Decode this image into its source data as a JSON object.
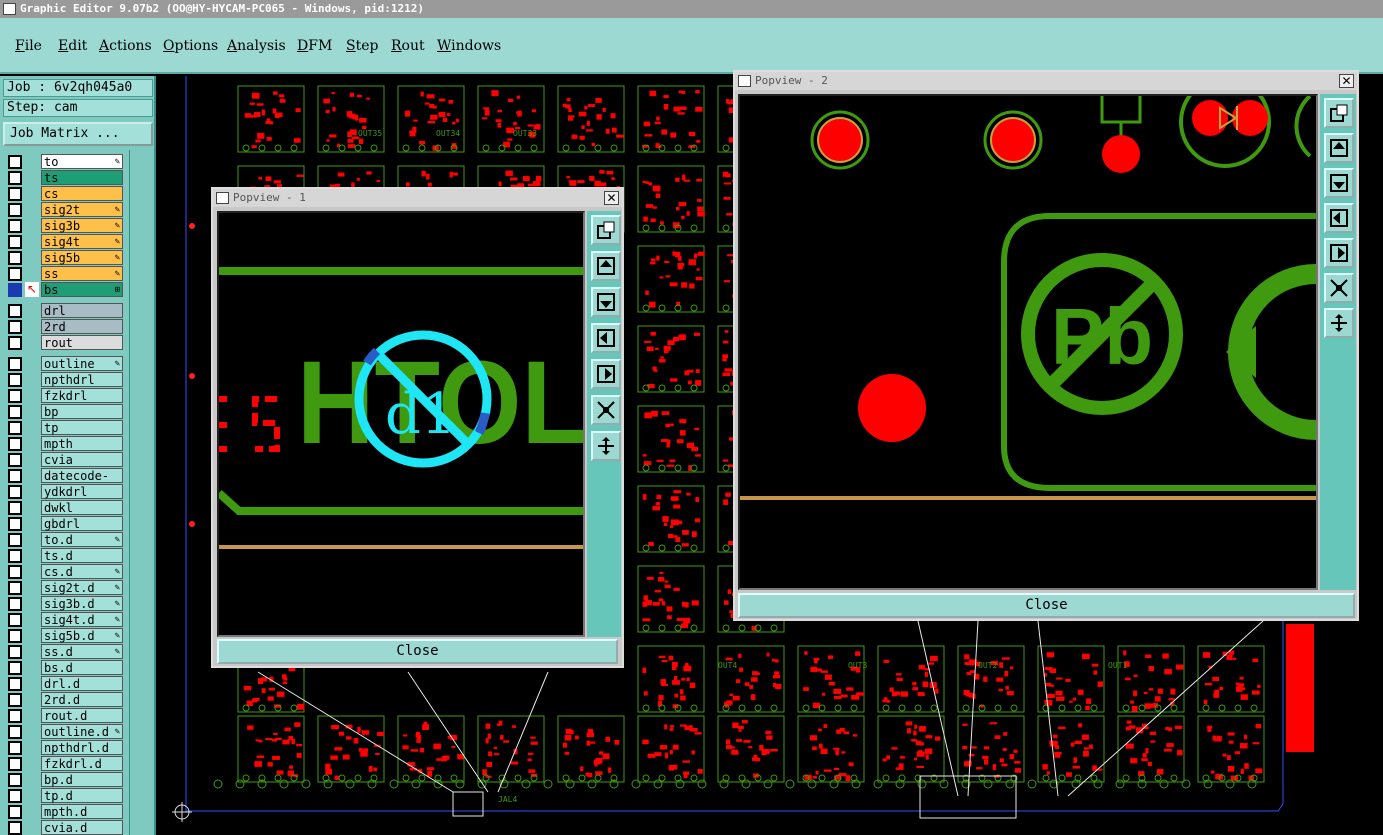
{
  "window": {
    "title": "Graphic Editor 9.07b2 (OO@HY-HYCAM-PC065 - Windows, pid:1212)"
  },
  "menu": [
    "File",
    "Edit",
    "Actions",
    "Options",
    "Analysis",
    "DFM",
    "Step",
    "Rout",
    "Windows"
  ],
  "job": {
    "label": "Job : 6v2qh045a0",
    "step": "Step: cam",
    "matrix_button": "Job Matrix ..."
  },
  "layers": [
    {
      "name": "to",
      "color": "#ffffff",
      "mark": "✎"
    },
    {
      "name": "ts",
      "color": "#1d9e74",
      "mark": ""
    },
    {
      "name": "cs",
      "color": "#ffc04a",
      "mark": ""
    },
    {
      "name": "sig2t",
      "color": "#ffc04a",
      "mark": "✎"
    },
    {
      "name": "sig3b",
      "color": "#ffc04a",
      "mark": "✎"
    },
    {
      "name": "sig4t",
      "color": "#ffc04a",
      "mark": "✎"
    },
    {
      "name": "sig5b",
      "color": "#ffc04a",
      "mark": "✎"
    },
    {
      "name": "ss",
      "color": "#ffc04a",
      "mark": "✎"
    },
    {
      "name": "bs",
      "color": "#1d9e74",
      "mark": "⊞"
    },
    {
      "name": "drl",
      "color": "#a7bcc4",
      "mark": ""
    },
    {
      "name": "2rd",
      "color": "#a7bcc4",
      "mark": ""
    },
    {
      "name": "rout",
      "color": "#dcdcdc",
      "mark": ""
    },
    {
      "name": "outline",
      "color": "#a4e0da",
      "mark": "✎"
    },
    {
      "name": "npthdrl",
      "color": "#a4e0da",
      "mark": ""
    },
    {
      "name": "fzkdrl",
      "color": "#a4e0da",
      "mark": ""
    },
    {
      "name": "bp",
      "color": "#a4e0da",
      "mark": ""
    },
    {
      "name": "tp",
      "color": "#a4e0da",
      "mark": ""
    },
    {
      "name": "mpth",
      "color": "#a4e0da",
      "mark": ""
    },
    {
      "name": "cvia",
      "color": "#a4e0da",
      "mark": ""
    },
    {
      "name": "datecode-bs",
      "color": "#a4e0da",
      "mark": ""
    },
    {
      "name": "ydkdrl",
      "color": "#a4e0da",
      "mark": ""
    },
    {
      "name": "dwkl",
      "color": "#a4e0da",
      "mark": ""
    },
    {
      "name": "gbdrl",
      "color": "#a4e0da",
      "mark": ""
    },
    {
      "name": "to.d",
      "color": "#a4e0da",
      "mark": "✎"
    },
    {
      "name": "ts.d",
      "color": "#a4e0da",
      "mark": ""
    },
    {
      "name": "cs.d",
      "color": "#a4e0da",
      "mark": "✎"
    },
    {
      "name": "sig2t.d",
      "color": "#a4e0da",
      "mark": "✎"
    },
    {
      "name": "sig3b.d",
      "color": "#a4e0da",
      "mark": "✎"
    },
    {
      "name": "sig4t.d",
      "color": "#a4e0da",
      "mark": "✎"
    },
    {
      "name": "sig5b.d",
      "color": "#a4e0da",
      "mark": "✎"
    },
    {
      "name": "ss.d",
      "color": "#a4e0da",
      "mark": "✎"
    },
    {
      "name": "bs.d",
      "color": "#a4e0da",
      "mark": ""
    },
    {
      "name": "drl.d",
      "color": "#a4e0da",
      "mark": ""
    },
    {
      "name": "2rd.d",
      "color": "#a4e0da",
      "mark": ""
    },
    {
      "name": "rout.d",
      "color": "#a4e0da",
      "mark": ""
    },
    {
      "name": "outline.d",
      "color": "#a4e0da",
      "mark": "✎"
    },
    {
      "name": "npthdrl.d",
      "color": "#a4e0da",
      "mark": ""
    },
    {
      "name": "fzkdrl.d",
      "color": "#a4e0da",
      "mark": ""
    },
    {
      "name": "bp.d",
      "color": "#a4e0da",
      "mark": ""
    },
    {
      "name": "tp.d",
      "color": "#a4e0da",
      "mark": ""
    },
    {
      "name": "mpth.d",
      "color": "#a4e0da",
      "mark": ""
    },
    {
      "name": "cvia.d",
      "color": "#a4e0da",
      "mark": ""
    }
  ],
  "popview1": {
    "title": "Popview - 1",
    "close_label": "Close",
    "silk_text": "HTOL",
    "drill_label": "d1"
  },
  "popview2": {
    "title": "Popview - 2",
    "close_label": "Close",
    "pb_label": "Pb"
  },
  "board_labels": [
    "OUT35",
    "OUT34",
    "OUT33",
    "OUT4",
    "OUT3",
    "OUT2",
    "OUT1",
    "JAL4"
  ],
  "colors": {
    "pad": "#ff0000",
    "silk": "#3f9a10",
    "accent": "#9cd9d3",
    "highlight": "#1ee6f5"
  }
}
